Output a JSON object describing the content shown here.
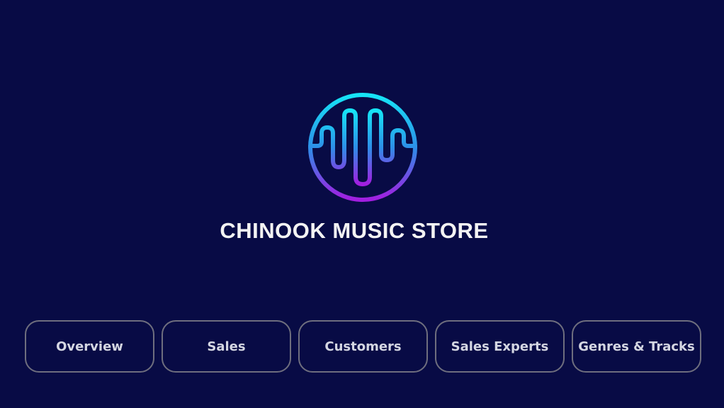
{
  "brand": {
    "logo_icon": "soundwave-circle-icon",
    "title": "CHINOOK MUSIC STORE",
    "colors": {
      "background": "#080b45",
      "gradient_top": "#16e4f6",
      "gradient_bottom": "#a21ee0",
      "button_border": "#6e6e7e",
      "button_text": "#d4d6e2"
    }
  },
  "nav": {
    "buttons": [
      {
        "label": "Overview"
      },
      {
        "label": "Sales"
      },
      {
        "label": "Customers"
      },
      {
        "label": "Sales Experts"
      },
      {
        "label": "Genres & Tracks"
      }
    ]
  }
}
